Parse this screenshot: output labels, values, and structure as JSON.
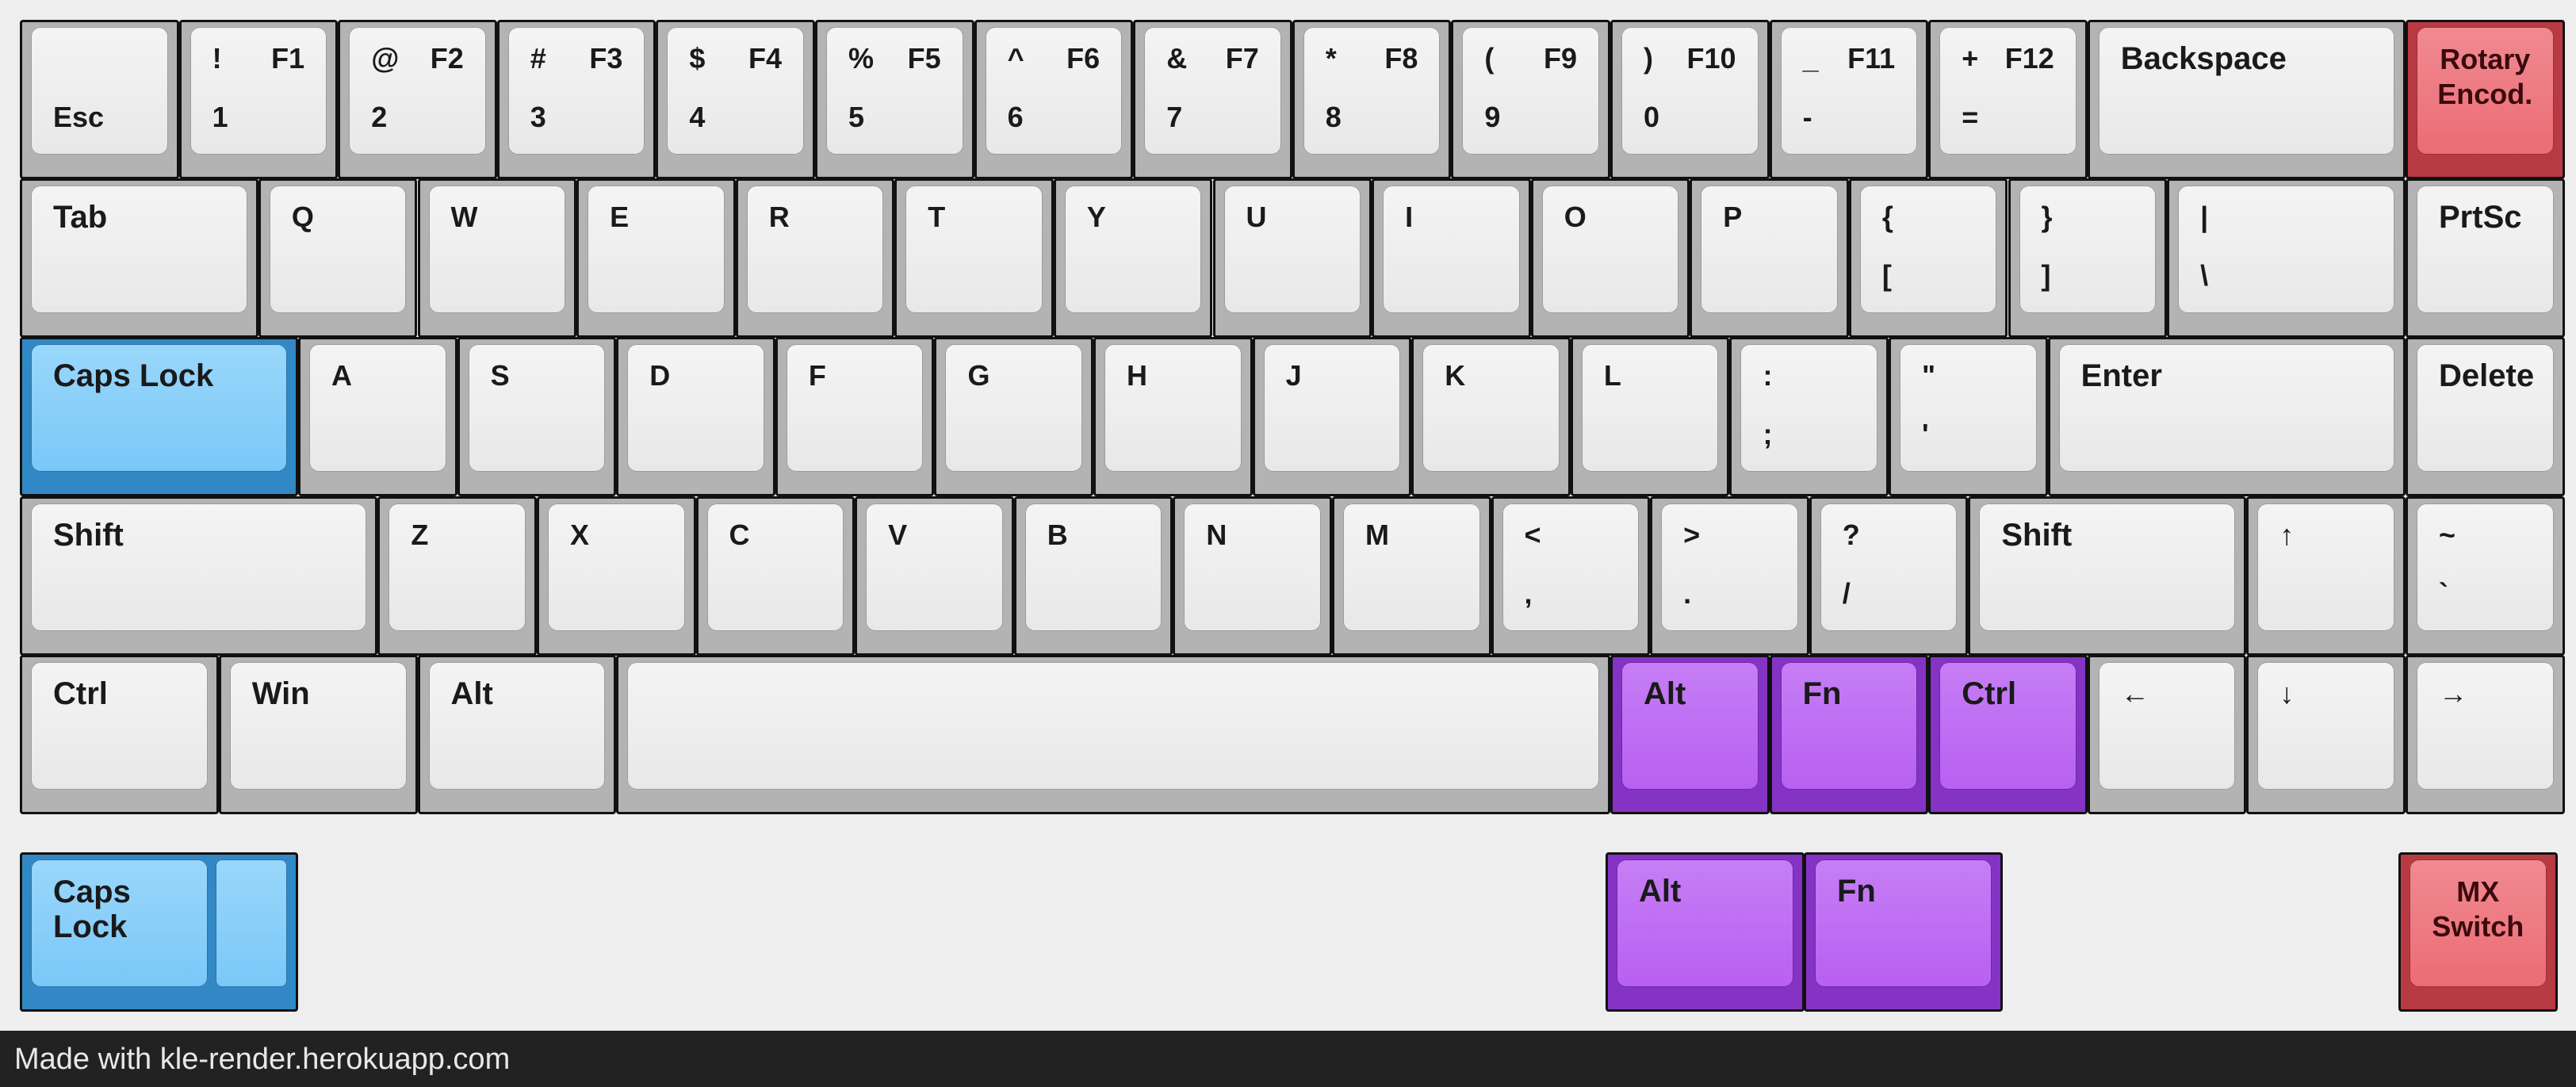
{
  "footer": {
    "text": "Made with kle-render.herokuapp.com"
  },
  "colors": {
    "white": "#e6e6e6",
    "blue": "#6fc3f7",
    "purple": "#b159f0",
    "red": "#e8616a",
    "background": "#eeeeee"
  },
  "rows": [
    [
      {
        "name": "esc",
        "legends": {
          "bl": "Esc"
        }
      },
      {
        "name": "1",
        "legends": {
          "tl": "!",
          "tr": "F1",
          "bl": "1"
        }
      },
      {
        "name": "2",
        "legends": {
          "tl": "@",
          "tr": "F2",
          "bl": "2"
        }
      },
      {
        "name": "3",
        "legends": {
          "tl": "#",
          "tr": "F3",
          "bl": "3"
        }
      },
      {
        "name": "4",
        "legends": {
          "tl": "$",
          "tr": "F4",
          "bl": "4"
        }
      },
      {
        "name": "5",
        "legends": {
          "tl": "%",
          "tr": "F5",
          "bl": "5"
        }
      },
      {
        "name": "6",
        "legends": {
          "tl": "^",
          "tr": "F6",
          "bl": "6"
        }
      },
      {
        "name": "7",
        "legends": {
          "tl": "&",
          "tr": "F7",
          "bl": "7"
        }
      },
      {
        "name": "8",
        "legends": {
          "tl": "*",
          "tr": "F8",
          "bl": "8"
        }
      },
      {
        "name": "9",
        "legends": {
          "tl": "(",
          "tr": "F9",
          "bl": "9"
        }
      },
      {
        "name": "0",
        "legends": {
          "tl": ")",
          "tr": "F10",
          "bl": "0"
        }
      },
      {
        "name": "minus",
        "legends": {
          "tl": "_",
          "tr": "F11",
          "bl": "-"
        }
      },
      {
        "name": "equals",
        "legends": {
          "tl": "+",
          "tr": "F12",
          "bl": "="
        }
      },
      {
        "name": "backspace",
        "w": 2,
        "legends": {
          "tl": "Backspace"
        }
      },
      {
        "name": "rotary-encoder",
        "color": "red",
        "legends": {
          "tc": "Rotary\nEncod."
        }
      }
    ],
    [
      {
        "name": "tab",
        "w": 1.5,
        "legends": {
          "tl": "Tab"
        }
      },
      {
        "name": "q",
        "legends": {
          "tl": "Q"
        }
      },
      {
        "name": "w",
        "legends": {
          "tl": "W"
        }
      },
      {
        "name": "e",
        "legends": {
          "tl": "E"
        }
      },
      {
        "name": "r",
        "legends": {
          "tl": "R"
        }
      },
      {
        "name": "t",
        "legends": {
          "tl": "T"
        }
      },
      {
        "name": "y",
        "legends": {
          "tl": "Y"
        }
      },
      {
        "name": "u",
        "legends": {
          "tl": "U"
        }
      },
      {
        "name": "i",
        "legends": {
          "tl": "I"
        }
      },
      {
        "name": "o",
        "legends": {
          "tl": "O"
        }
      },
      {
        "name": "p",
        "legends": {
          "tl": "P"
        }
      },
      {
        "name": "left-bracket",
        "legends": {
          "tl": "{",
          "bl": "["
        }
      },
      {
        "name": "right-bracket",
        "legends": {
          "tl": "}",
          "bl": "]"
        }
      },
      {
        "name": "backslash",
        "w": 1.5,
        "legends": {
          "tl": "|",
          "bl": "\\"
        }
      },
      {
        "name": "prtsc",
        "legends": {
          "tl": "PrtSc"
        }
      }
    ],
    [
      {
        "name": "caps-lock",
        "w": 1.75,
        "color": "blue",
        "legends": {
          "tl": "Caps Lock"
        }
      },
      {
        "name": "a",
        "legends": {
          "tl": "A"
        }
      },
      {
        "name": "s",
        "legends": {
          "tl": "S"
        }
      },
      {
        "name": "d",
        "legends": {
          "tl": "D"
        }
      },
      {
        "name": "f",
        "legends": {
          "tl": "F"
        }
      },
      {
        "name": "g",
        "legends": {
          "tl": "G"
        }
      },
      {
        "name": "h",
        "legends": {
          "tl": "H"
        }
      },
      {
        "name": "j",
        "legends": {
          "tl": "J"
        }
      },
      {
        "name": "k",
        "legends": {
          "tl": "K"
        }
      },
      {
        "name": "l",
        "legends": {
          "tl": "L"
        }
      },
      {
        "name": "semicolon",
        "legends": {
          "tl": ":",
          "bl": ";"
        }
      },
      {
        "name": "quote",
        "legends": {
          "tl": "\"",
          "bl": "'"
        }
      },
      {
        "name": "enter",
        "w": 2.25,
        "legends": {
          "tl": "Enter"
        }
      },
      {
        "name": "delete",
        "legends": {
          "tl": "Delete"
        }
      }
    ],
    [
      {
        "name": "left-shift",
        "w": 2.25,
        "legends": {
          "tl": "Shift"
        }
      },
      {
        "name": "z",
        "legends": {
          "tl": "Z"
        }
      },
      {
        "name": "x",
        "legends": {
          "tl": "X"
        }
      },
      {
        "name": "c",
        "legends": {
          "tl": "C"
        }
      },
      {
        "name": "v",
        "legends": {
          "tl": "V"
        }
      },
      {
        "name": "b",
        "legends": {
          "tl": "B"
        }
      },
      {
        "name": "n",
        "legends": {
          "tl": "N"
        }
      },
      {
        "name": "m",
        "legends": {
          "tl": "M"
        }
      },
      {
        "name": "comma",
        "legends": {
          "tl": "<",
          "bl": ","
        }
      },
      {
        "name": "period",
        "legends": {
          "tl": ">",
          "bl": "."
        }
      },
      {
        "name": "slash",
        "legends": {
          "tl": "?",
          "bl": "/"
        }
      },
      {
        "name": "right-shift",
        "w": 1.75,
        "legends": {
          "tl": "Shift"
        }
      },
      {
        "name": "up-arrow",
        "legends": {
          "tl": "↑"
        }
      },
      {
        "name": "tilde",
        "legends": {
          "tl": "~",
          "bl": "`"
        }
      }
    ],
    [
      {
        "name": "left-ctrl",
        "w": 1.25,
        "legends": {
          "tl": "Ctrl"
        }
      },
      {
        "name": "win",
        "w": 1.25,
        "legends": {
          "tl": "Win"
        }
      },
      {
        "name": "left-alt",
        "w": 1.25,
        "legends": {
          "tl": "Alt"
        }
      },
      {
        "name": "spacebar",
        "w": 6.25,
        "legends": {}
      },
      {
        "name": "right-alt",
        "color": "purple",
        "legends": {
          "tl": "Alt"
        }
      },
      {
        "name": "fn",
        "color": "purple",
        "legends": {
          "tl": "Fn"
        }
      },
      {
        "name": "right-ctrl",
        "color": "purple",
        "legends": {
          "tl": "Ctrl"
        }
      },
      {
        "name": "left-arrow",
        "legends": {
          "tl": "←"
        }
      },
      {
        "name": "down-arrow",
        "legends": {
          "tl": "↓"
        }
      },
      {
        "name": "right-arrow",
        "legends": {
          "tl": "→"
        }
      }
    ]
  ],
  "extras": [
    {
      "name": "caps-lock-stepped",
      "color": "blue",
      "w": 1.75,
      "stepped": true,
      "legends": {
        "tl": "Caps\nLock"
      }
    },
    {
      "name": "alt-alt",
      "color": "purple",
      "w": 1.25,
      "legends": {
        "tl": "Alt"
      }
    },
    {
      "name": "fn-alt",
      "color": "purple",
      "w": 1.25,
      "legends": {
        "tl": "Fn"
      }
    },
    {
      "name": "mx-switch",
      "color": "red",
      "legends": {
        "tc": "MX\nSwitch"
      }
    }
  ]
}
